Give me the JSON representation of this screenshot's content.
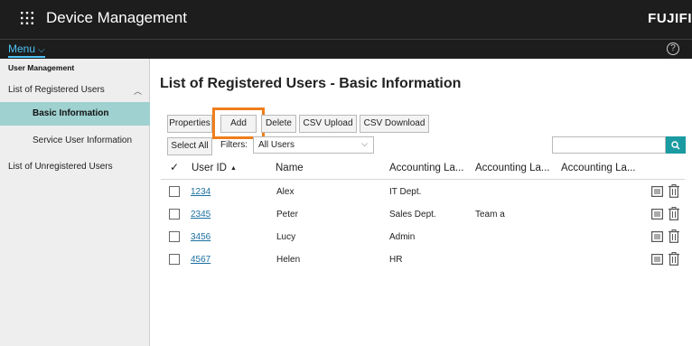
{
  "header": {
    "app_title": "Device Management",
    "brand": "FUJIFI",
    "menu_label": "Menu",
    "help_glyph": "?",
    "accent_color": "#4fc3f7"
  },
  "sidebar": {
    "section_title": "User Management",
    "items": [
      {
        "label": "List of Registered Users",
        "expanded": true
      },
      {
        "label": "Basic Information",
        "selected": true
      },
      {
        "label": "Service User Information"
      },
      {
        "label": "List of Unregistered Users"
      }
    ],
    "selected_color": "#9ed1d0"
  },
  "main": {
    "title": "List of Registered Users - Basic Information",
    "toolbar": {
      "properties": "Properties",
      "add": "Add",
      "delete": "Delete",
      "csv_upload": "CSV Upload",
      "csv_download": "CSV Download",
      "highlight_color": "#f07e1b"
    },
    "filter_bar": {
      "select_all": "Select All",
      "filters_label": "Filters:",
      "filter_value": "All Users",
      "search_value": ""
    },
    "table": {
      "columns": [
        "User ID",
        "Name",
        "Accounting La...",
        "Accounting La...",
        "Accounting La..."
      ],
      "sort_indicator": "▲",
      "rows": [
        {
          "user_id": "1234",
          "name": "Alex",
          "acc1": "IT Dept.",
          "acc2": ""
        },
        {
          "user_id": "2345",
          "name": "Peter",
          "acc1": "Sales Dept.",
          "acc2": "Team a"
        },
        {
          "user_id": "3456",
          "name": "Lucy",
          "acc1": "Admin",
          "acc2": ""
        },
        {
          "user_id": "4567",
          "name": "Helen",
          "acc1": "HR",
          "acc2": ""
        }
      ]
    }
  }
}
